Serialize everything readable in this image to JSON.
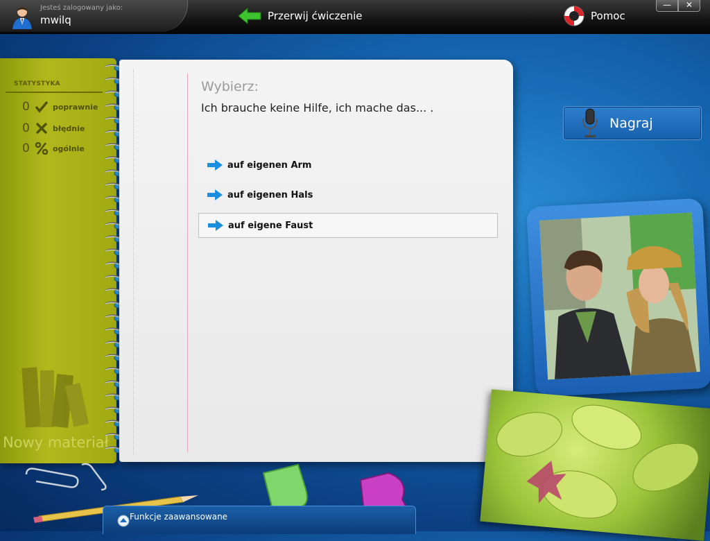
{
  "header": {
    "login_caption": "Jesteś zalogowany jako:",
    "username": "mwilq",
    "abort_label": "Przerwij ćwiczenie",
    "help_label": "Pomoc",
    "minimize_glyph": "—",
    "close_glyph": "✕"
  },
  "statistics": {
    "title": "STATYSTYKA",
    "rows": [
      {
        "value": "0",
        "label": "poprawnie",
        "icon": "check-icon"
      },
      {
        "value": "0",
        "label": "błędnie",
        "icon": "cross-icon"
      },
      {
        "value": "0",
        "label": "ogólnie",
        "icon": "percent-icon"
      }
    ],
    "new_material": "Nowy materiał"
  },
  "exercise": {
    "instruction": "Wybierz:",
    "question": "Ich brauche keine Hilfe, ich mache das... .",
    "options": [
      {
        "label": "auf eigenen Arm",
        "selected": false
      },
      {
        "label": "auf eigenen Hals",
        "selected": false
      },
      {
        "label": "auf eigene Faust",
        "selected": true
      }
    ]
  },
  "record": {
    "label": "Nagraj"
  },
  "advanced": {
    "label": "Funkcje zaawansowane"
  },
  "colors": {
    "accent_arrow": "#1a8fe0",
    "abort_arrow": "#3ec22e",
    "notebook_green": "#a5ad14"
  }
}
